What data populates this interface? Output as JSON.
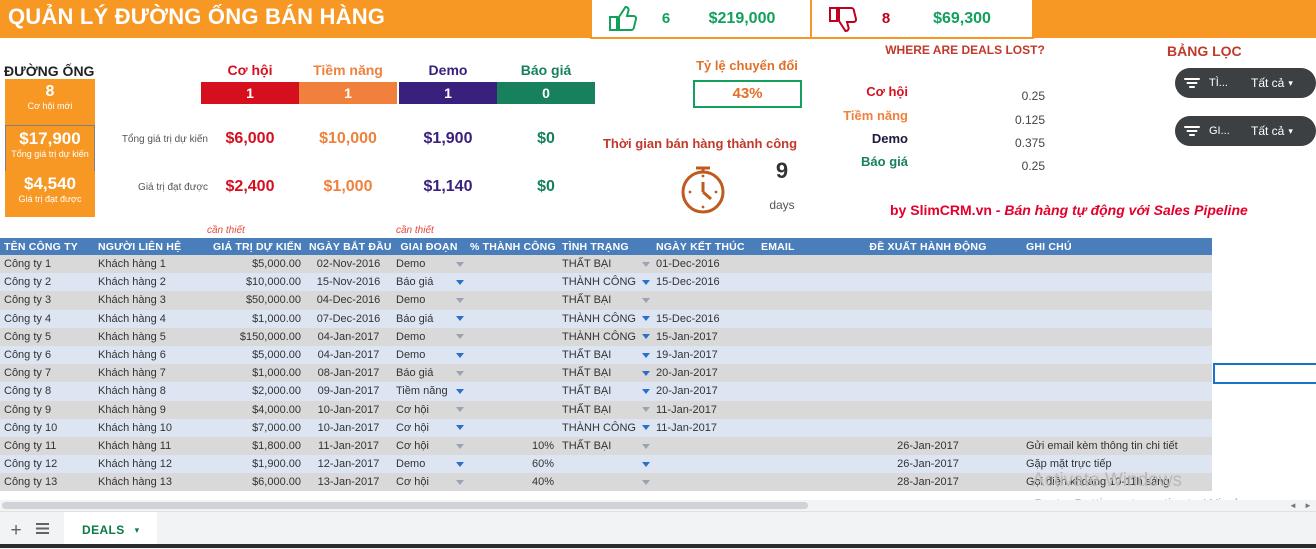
{
  "app": {
    "title": "QUẢN LÝ ĐƯỜNG ỐNG BÁN HÀNG",
    "brand_color": "#f79824"
  },
  "kpi": {
    "won": {
      "icon": "thumbs-up-icon",
      "count": "6",
      "value": "$219,000",
      "color": "#12a05c"
    },
    "lost": {
      "icon": "thumbs-down-icon",
      "count": "8",
      "value": "$69,300",
      "count_color": "#c00020",
      "value_color": "#12a05c"
    }
  },
  "sidebar": {
    "label": "ĐƯỜNG ỐNG",
    "boxes": [
      {
        "value": "8",
        "caption": "Cơ hội mới"
      },
      {
        "value": "$17,900",
        "caption": "Tổng giá trị dự kiến"
      },
      {
        "value": "$4,540",
        "caption": "Giá trị đạt được"
      }
    ]
  },
  "funnel": {
    "row_labels": {
      "expected": "Tổng giá trị dự kiến",
      "achieved": "Giá trị đạt được"
    },
    "stages": [
      {
        "name": "Cơ hội",
        "count": "1",
        "color": "#d50f1e",
        "expected": "$6,000",
        "achieved": "$2,400"
      },
      {
        "name": "Tiềm năng",
        "count": "1",
        "color": "#f0803c",
        "expected": "$10,000",
        "achieved": "$1,000"
      },
      {
        "name": "Demo",
        "count": "1",
        "color": "#39207c",
        "expected": "$1,900",
        "achieved": "$1,140"
      },
      {
        "name": "Báo giá",
        "count": "0",
        "color": "#17805c",
        "expected": "$0",
        "achieved": "$0"
      }
    ]
  },
  "conversion": {
    "label": "Tỷ lệ chuyển đổi",
    "value": "43%",
    "cycle_label": "Thời gian bán hàng thành công",
    "cycle_value": "9",
    "cycle_unit": "days",
    "stopwatch_icon": "stopwatch-icon"
  },
  "lost": {
    "title": "WHERE ARE DEALS LOST?",
    "rows": [
      {
        "stage": "Cơ hội",
        "value": "0.25",
        "color": "#d50f1e"
      },
      {
        "stage": "Tiềm năng",
        "value": "0.125",
        "color": "#f0803c"
      },
      {
        "stage": "Demo",
        "value": "0.375",
        "color": "#1a1a3c"
      },
      {
        "stage": "Báo giá",
        "value": "0.25",
        "color": "#17805c"
      }
    ]
  },
  "credit": {
    "prefix": "by SlimCRM.vn ",
    "suffix": "- Bán hàng tự động với Sales Pipeline"
  },
  "filter_panel": {
    "title": "BẢNG LỌC",
    "filters": [
      {
        "icon": "filter-icon",
        "name": "TÌ...",
        "value": "Tất cả",
        "caret": "▾"
      },
      {
        "icon": "filter-icon",
        "name": "GI...",
        "value": "Tất cả",
        "caret": "▾"
      }
    ]
  },
  "required_notes": [
    "cần thiết",
    "cần thiết"
  ],
  "table": {
    "columns": [
      "TÊN CÔNG TY",
      "NGƯỜI LIÊN HỆ",
      "GIÁ TRỊ DỰ KIẾN",
      "NGÀY BẮT ĐẦU",
      "GIAI ĐOẠN",
      "% THÀNH CÔNG",
      "TÌNH TRẠNG",
      "NGÀY KẾT THÚC",
      "EMAIL",
      "ĐỀ XUẤT HÀNH ĐỘNG",
      "GHI CHÚ"
    ],
    "rows": [
      {
        "company": "Công ty  1",
        "contact": "Khách hàng 1",
        "value": "$5,000.00",
        "start": "02-Nov-2016",
        "stage": "Demo",
        "pct": "",
        "status": "THẤT BẠI",
        "end": "01-Dec-2016",
        "email": "",
        "action": "",
        "note": ""
      },
      {
        "company": "Công ty  2",
        "contact": "Khách hàng 2",
        "value": "$10,000.00",
        "start": "15-Nov-2016",
        "stage": "Báo giá",
        "pct": "",
        "status": "THÀNH CÔNG",
        "end": "15-Dec-2016",
        "email": "",
        "action": "",
        "note": ""
      },
      {
        "company": "Công ty  3",
        "contact": "Khách hàng 3",
        "value": "$50,000.00",
        "start": "04-Dec-2016",
        "stage": "Demo",
        "pct": "",
        "status": "THẤT BẠI",
        "end": "",
        "email": "",
        "action": "",
        "note": ""
      },
      {
        "company": "Công ty  4",
        "contact": "Khách hàng 4",
        "value": "$1,000.00",
        "start": "07-Dec-2016",
        "stage": "Báo giá",
        "pct": "",
        "status": "THÀNH CÔNG",
        "end": "15-Dec-2016",
        "email": "",
        "action": "",
        "note": ""
      },
      {
        "company": "Công ty  5",
        "contact": "Khách hàng 5",
        "value": "$150,000.00",
        "start": "04-Jan-2017",
        "stage": "Demo",
        "pct": "",
        "status": "THÀNH CÔNG",
        "end": "15-Jan-2017",
        "email": "",
        "action": "",
        "note": ""
      },
      {
        "company": "Công ty  6",
        "contact": "Khách hàng 6",
        "value": "$5,000.00",
        "start": "04-Jan-2017",
        "stage": "Demo",
        "pct": "",
        "status": "THẤT BẠI",
        "end": "19-Jan-2017",
        "email": "",
        "action": "",
        "note": ""
      },
      {
        "company": "Công ty  7",
        "contact": "Khách hàng 7",
        "value": "$1,000.00",
        "start": "08-Jan-2017",
        "stage": "Báo giá",
        "pct": "",
        "status": "THẤT BẠI",
        "end": "20-Jan-2017",
        "email": "",
        "action": "",
        "note": ""
      },
      {
        "company": "Công ty  8",
        "contact": "Khách hàng 8",
        "value": "$2,000.00",
        "start": "09-Jan-2017",
        "stage": "Tiềm năng",
        "pct": "",
        "status": "THẤT BẠI",
        "end": "20-Jan-2017",
        "email": "",
        "action": "",
        "note": ""
      },
      {
        "company": "Công ty  9",
        "contact": "Khách hàng 9",
        "value": "$4,000.00",
        "start": "10-Jan-2017",
        "stage": "Cơ hội",
        "pct": "",
        "status": "THẤT BẠI",
        "end": "11-Jan-2017",
        "email": "",
        "action": "",
        "note": ""
      },
      {
        "company": "Công ty  10",
        "contact": "Khách hàng 10",
        "value": "$7,000.00",
        "start": "10-Jan-2017",
        "stage": "Cơ hội",
        "pct": "",
        "status": "THÀNH CÔNG",
        "end": "11-Jan-2017",
        "email": "",
        "action": "",
        "note": ""
      },
      {
        "company": "Công ty  11",
        "contact": "Khách hàng 11",
        "value": "$1,800.00",
        "start": "11-Jan-2017",
        "stage": "Cơ hội",
        "pct": "10%",
        "status": "THẤT BẠI",
        "end": "",
        "email": "",
        "action": "26-Jan-2017",
        "note": "Gửi email kèm thông tin chi tiết"
      },
      {
        "company": "Công ty  12",
        "contact": "Khách hàng 12",
        "value": "$1,900.00",
        "start": "12-Jan-2017",
        "stage": "Demo",
        "pct": "60%",
        "status": "",
        "end": "",
        "email": "",
        "action": "26-Jan-2017",
        "note": "Gặp mặt trực tiếp"
      },
      {
        "company": "Công ty  13",
        "contact": "Khách hàng 13",
        "value": "$6,000.00",
        "start": "13-Jan-2017",
        "stage": "Cơ hội",
        "pct": "40%",
        "status": "",
        "end": "",
        "email": "",
        "action": "28-Jan-2017",
        "note": "Gọi điện khoảng 10-11h sáng"
      }
    ]
  },
  "watermark": {
    "line1": "Activate Windows",
    "line2": "Go to Settings to activate Windows."
  },
  "bottom": {
    "add_icon": "plus-icon",
    "all_sheets_icon": "hamburger-icon",
    "sheet_name": "DEALS",
    "sheet_caret": "▾",
    "scroll_left": "◄",
    "scroll_right": "►"
  }
}
